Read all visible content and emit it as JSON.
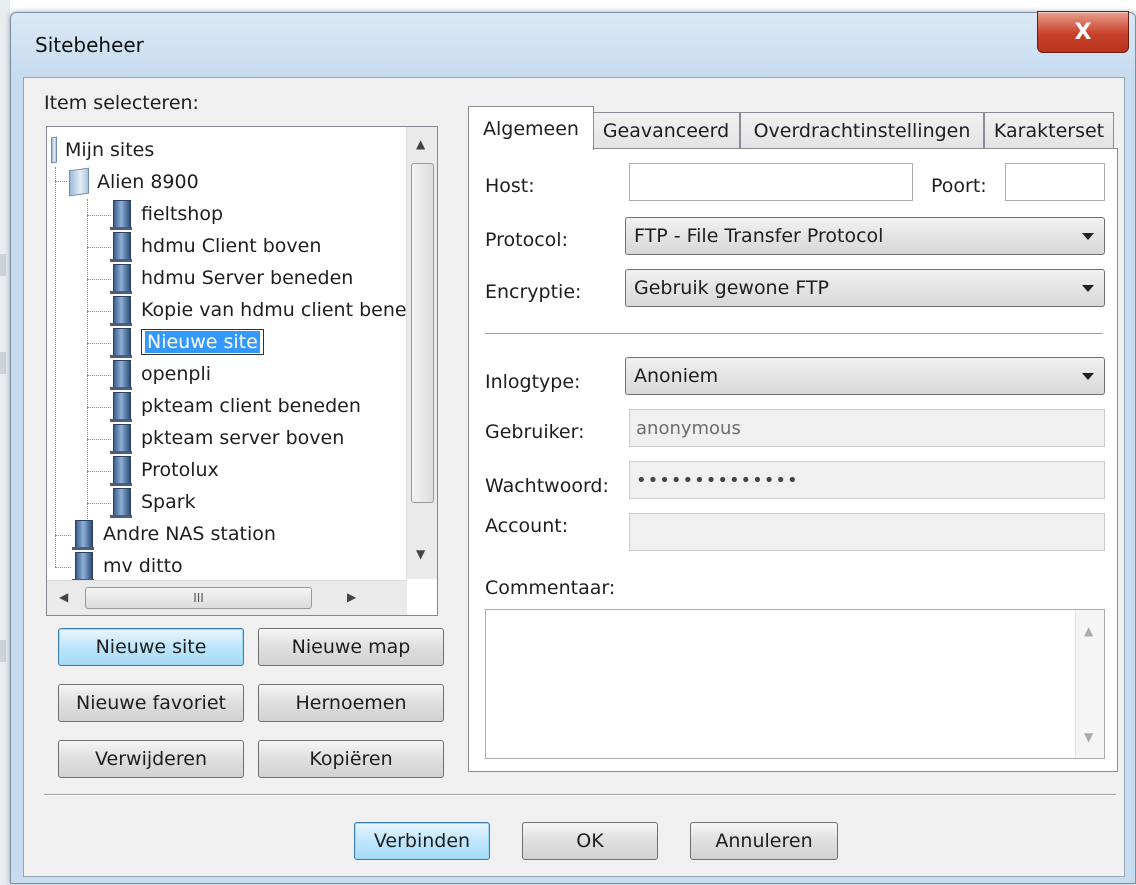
{
  "window": {
    "title": "Sitebeheer",
    "close_glyph": "X"
  },
  "tree": {
    "label": "Item selecteren:",
    "root": "Mijn sites",
    "group": "Alien 8900",
    "children": [
      "fieltshop",
      "hdmu Client boven",
      "hdmu Server beneden",
      "Kopie van hdmu client bene",
      "Nieuwe site",
      "openpli",
      "pkteam client beneden",
      "pkteam server boven",
      "Protolux",
      "Spark"
    ],
    "selected": "Nieuwe site",
    "siblings": [
      "Andre NAS station",
      "mv ditto"
    ]
  },
  "buttons": {
    "new_site": "Nieuwe site",
    "new_folder": "Nieuwe map",
    "new_bookmark": "Nieuwe favoriet",
    "rename": "Hernoemen",
    "delete": "Verwijderen",
    "copy": "Kopiëren",
    "connect": "Verbinden",
    "ok": "OK",
    "cancel": "Annuleren"
  },
  "tabs": [
    "Algemeen",
    "Geavanceerd",
    "Overdrachtinstellingen",
    "Karakterset"
  ],
  "general": {
    "host_label": "Host:",
    "host_value": "",
    "port_label": "Poort:",
    "port_value": "",
    "protocol_label": "Protocol:",
    "protocol_value": "FTP - File Transfer Protocol",
    "encryption_label": "Encryptie:",
    "encryption_value": "Gebruik gewone FTP",
    "logon_label": "Inlogtype:",
    "logon_value": "Anoniem",
    "user_label": "Gebruiker:",
    "user_value": "anonymous",
    "password_label": "Wachtwoord:",
    "password_value": "••••••••••••••",
    "account_label": "Account:",
    "account_value": "",
    "comments_label": "Commentaar:"
  },
  "scroll": {
    "grip": "III"
  }
}
